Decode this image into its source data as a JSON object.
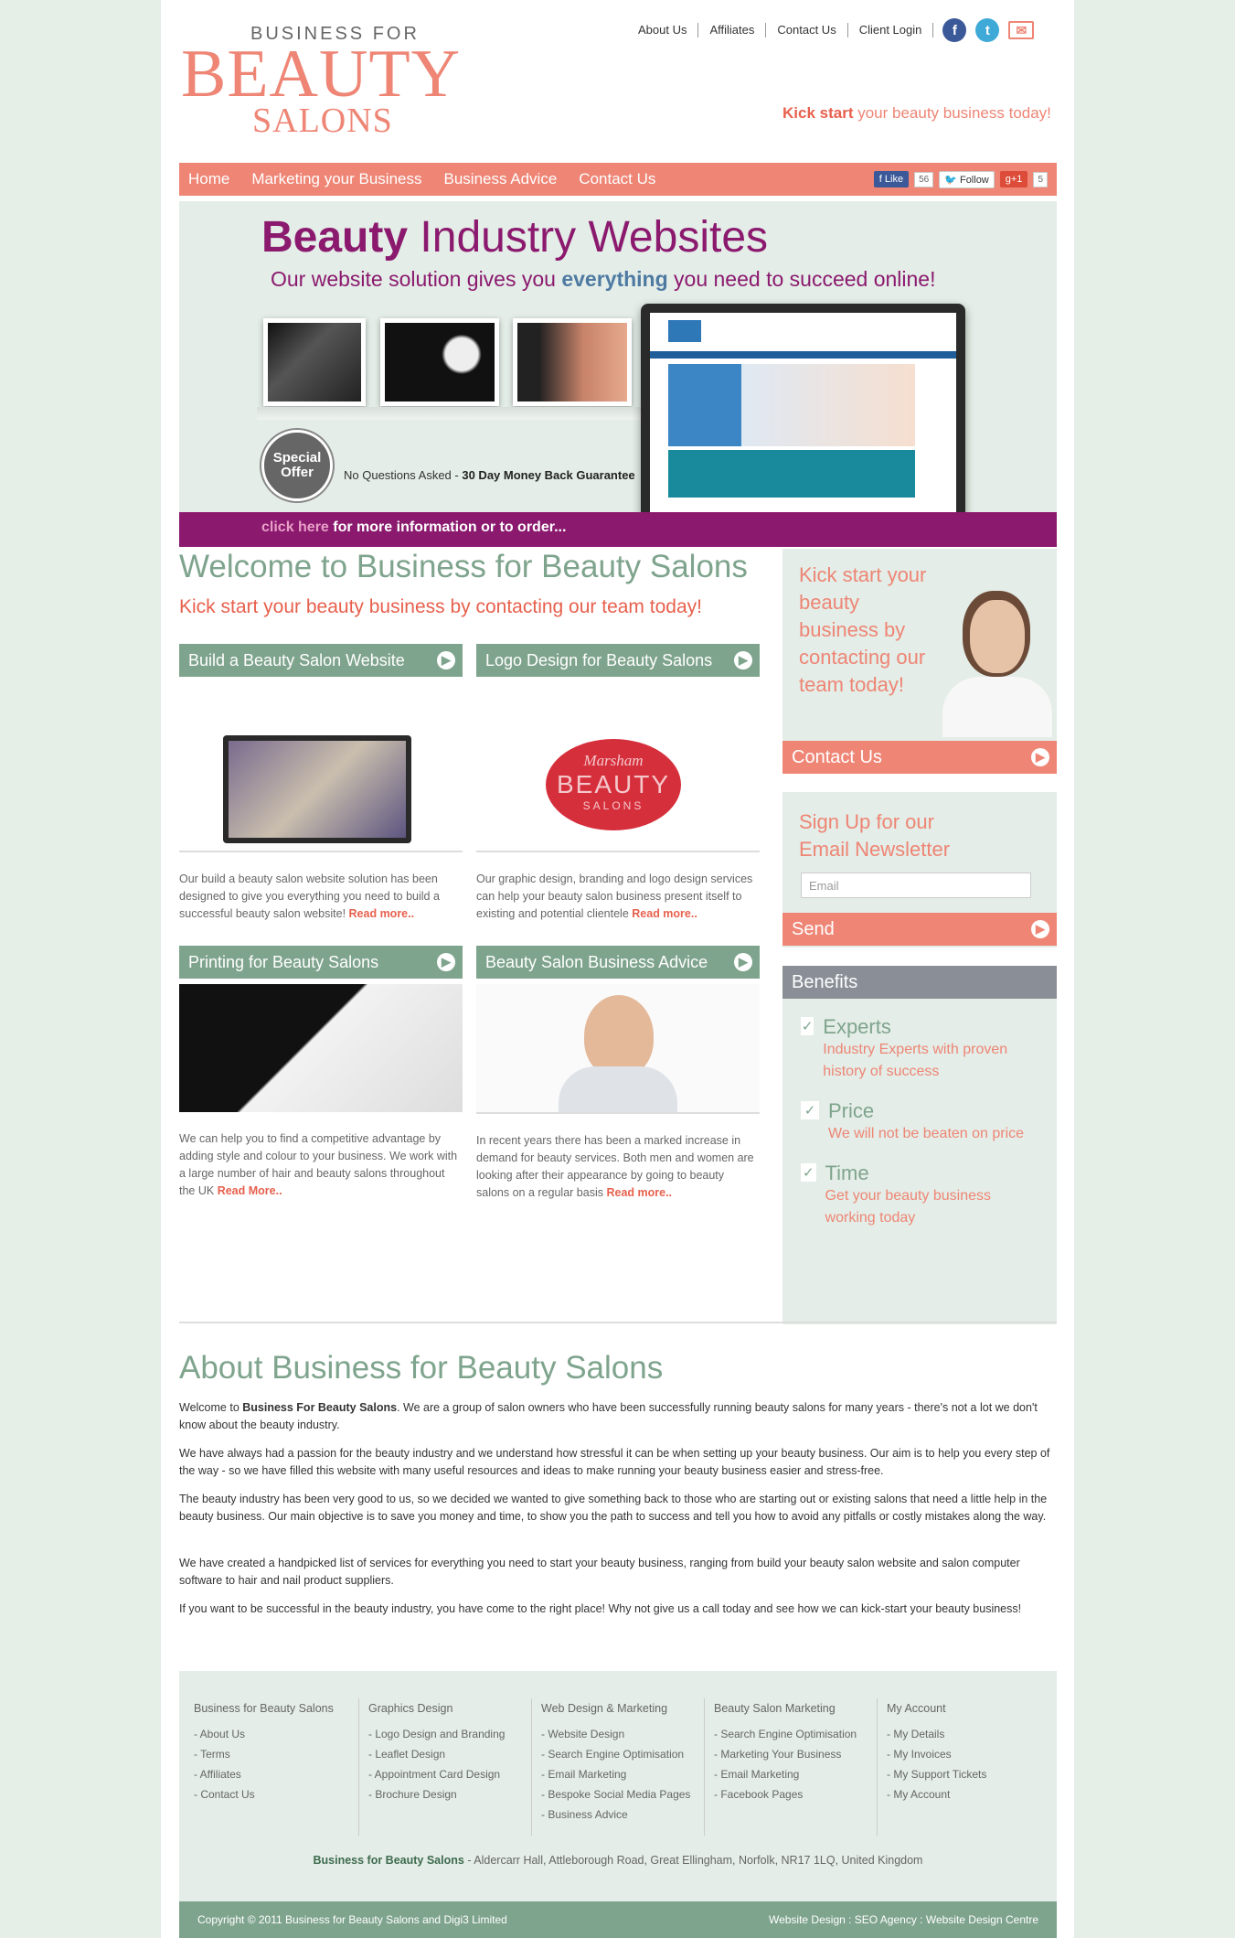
{
  "logo": {
    "top": "BUSINESS FOR",
    "big": "BEAUTY",
    "sub": "SALONS"
  },
  "toplinks": [
    "About Us",
    "Affiliates",
    "Contact Us",
    "Client Login"
  ],
  "tagline": {
    "bold": "Kick start",
    "rest": "your beauty business today!"
  },
  "nav": [
    "Home",
    "Marketing your Business",
    "Business Advice",
    "Contact Us"
  ],
  "share": {
    "fb_label": "Like",
    "fb_count": "56",
    "tw_label": "Follow",
    "gp_label": "g+1",
    "gp_count": "5"
  },
  "banner": {
    "title_bold": "Beauty",
    "title_rest": "Industry Websites",
    "sub_a": "Our website solution gives you",
    "sub_b": "everything",
    "sub_c": "you need to succeed online!",
    "special": "Special Offer",
    "guarantee_a": "No Questions Asked -",
    "guarantee_b": "30 Day Money Back Guarantee",
    "click": "click here",
    "click_rest": "for more information or to order..."
  },
  "welcome": {
    "title": "Welcome to Business for Beauty Salons",
    "kick": "Kick start your beauty business by contacting our team today!"
  },
  "sections": [
    {
      "title": "Build a Beauty Salon Website",
      "text": "Our build a beauty salon website solution has been designed to give you everything you need to build a successful beauty salon website!",
      "more": "Read more.."
    },
    {
      "title": "Logo Design for Beauty Salons",
      "text": "Our graphic design, branding and logo design services can help your beauty salon business present itself to existing and potential clientele",
      "more": "Read more.."
    },
    {
      "title": "Printing for Beauty Salons",
      "text": "We can help you to find a competitive advantage by adding style and colour to your business. We work with a large number of hair and beauty salons throughout the UK",
      "more": "Read More.."
    },
    {
      "title": "Beauty Salon Business Advice",
      "text": "In recent years there has been a marked increase in demand for beauty services. Both men and women are looking after their appearance by going to beauty salons on a regular basis",
      "more": "Read more.."
    }
  ],
  "logo_sample": {
    "script": "Marsham",
    "big": "BEAUTY",
    "small": "SALONS"
  },
  "sidebar": {
    "contact_text": "Kick start your beauty business by contacting our team today!",
    "contact_btn": "Contact Us",
    "newsletter_title": "Sign Up for our Email Newsletter",
    "email_placeholder": "Email",
    "send": "Send",
    "benefits_hdr": "Benefits",
    "benefits": [
      {
        "name": "Experts",
        "desc": "Industry Experts with proven history of success"
      },
      {
        "name": "Price",
        "desc": "We will not be beaten on price"
      },
      {
        "name": "Time",
        "desc": "Get your beauty business working today"
      }
    ]
  },
  "about": {
    "title": "About Business for Beauty Salons",
    "p1_a": "Welcome to",
    "p1_b": "Business For Beauty Salons",
    "p1_c": ". We are a group of salon owners who have been successfully running beauty salons for many years - there's not a lot we don't know about the beauty industry.",
    "p2": "We have always had a passion for the beauty industry and we understand how stressful it can be when setting up your beauty business. Our aim is to help you every step of the way - so we have filled this website with many useful resources and ideas to make running your beauty business easier and stress-free.",
    "p3": "The beauty industry has been very good to us, so we decided we wanted to give something back to those who are starting out or existing salons that need a little help in the beauty business. Our main objective is to save you money and time, to show you the path to success and tell you how to avoid any pitfalls or costly mistakes along the way.",
    "p4": "We have created a handpicked list of services for everything you need to start your beauty business, ranging from build your beauty salon website and salon computer software to hair and nail product suppliers.",
    "p5": "If you want to be successful in the beauty industry, you have come to the right place! Why not give us a call today and see how we can kick-start your beauty business!"
  },
  "footer": {
    "cols": [
      {
        "title": "Business for Beauty Salons",
        "items": [
          "- About Us",
          "- Terms",
          "- Affiliates",
          "- Contact Us"
        ]
      },
      {
        "title": "Graphics Design",
        "items": [
          "- Logo Design and Branding",
          "- Leaflet Design",
          "- Appointment Card Design",
          "- Brochure Design"
        ]
      },
      {
        "title": "Web Design & Marketing",
        "items": [
          "- Website Design",
          "- Search Engine Optimisation",
          "- Email Marketing",
          "- Bespoke Social Media Pages",
          "- Business Advice"
        ]
      },
      {
        "title": "Beauty Salon Marketing",
        "items": [
          "- Search Engine Optimisation",
          "- Marketing Your Business",
          "- Email Marketing",
          "- Facebook Pages"
        ]
      },
      {
        "title": "My Account",
        "items": [
          "- My Details",
          "- My Invoices",
          "- My Support Tickets",
          "- My Account"
        ]
      }
    ],
    "addr_bold": "Business for Beauty Salons",
    "addr_rest": "- Aldercarr Hall, Attleborough Road, Great Ellingham, Norfolk, NR17 1LQ, United Kingdom",
    "copyright": "Copyright © 2011 Business for Beauty Salons and Digi3 Limited",
    "credits": "Website Design : SEO Agency : Website Design Centre"
  },
  "colors": {
    "salmon": "#ee8575",
    "green": "#7fa48d",
    "purple": "#8b1a6f",
    "grey_header": "#8a8f97"
  }
}
